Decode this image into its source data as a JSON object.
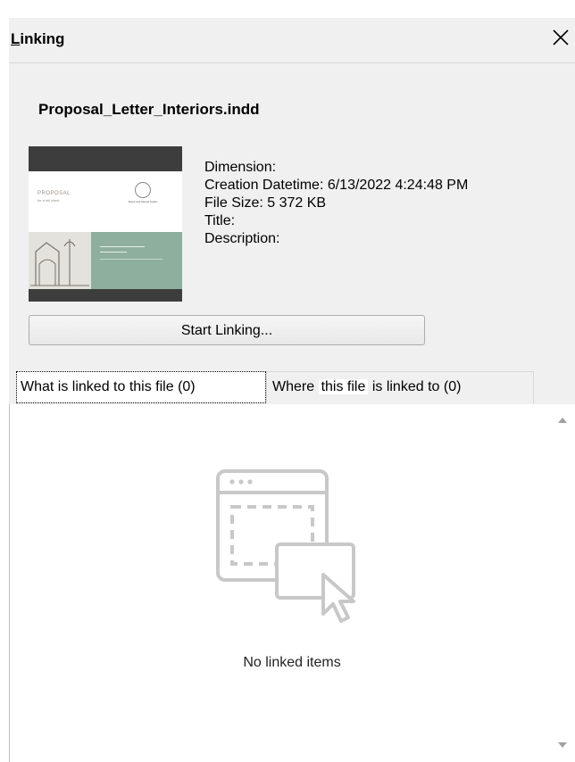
{
  "window": {
    "title_accel": "L",
    "title_rest": "inking",
    "close_label": "✕"
  },
  "file": {
    "name": "Proposal_Letter_Interiors.indd",
    "thumbnail_icon": "document-preview-thumbnail",
    "thumbnail": {
      "brand_text": "PROPOSAL",
      "brand_sub": "for a bill client",
      "seal_text": "Sears and Meeds Studio"
    },
    "properties": {
      "dimension": "Dimension:",
      "creation": "Creation Datetime: 6/13/2022 4:24:48 PM",
      "size": "File Size: 5 372 KB",
      "title": "Title:",
      "description": "Description:"
    }
  },
  "actions": {
    "start_linking": "Start Linking..."
  },
  "tabs": [
    {
      "label": "What is linked to this file (0)",
      "active": true
    },
    {
      "label_a": "Where ",
      "label_b": "this file",
      "label_c": " is linked to (0)",
      "active": false
    }
  ],
  "empty_state": {
    "icon": "linked-window-cursor-icon",
    "text": "No linked items"
  },
  "colors": {
    "panel_bg": "#f0f0f0",
    "content_bg": "#ffffff",
    "thumbnail_accent": "#8eaf9e",
    "icon_gray": "#c8c8c8"
  }
}
